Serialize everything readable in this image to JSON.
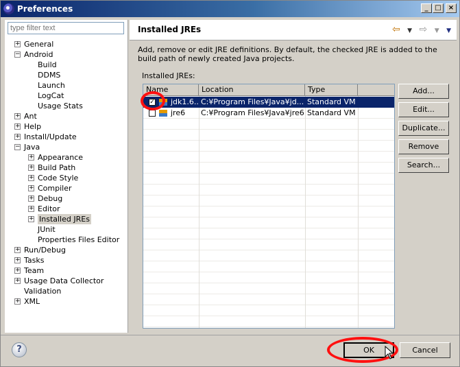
{
  "window": {
    "title": "Preferences"
  },
  "filter": {
    "placeholder": "type filter text"
  },
  "tree": [
    {
      "label": "General",
      "level": 0,
      "expander": "plus"
    },
    {
      "label": "Android",
      "level": 0,
      "expander": "minus"
    },
    {
      "label": "Build",
      "level": 1,
      "expander": "none"
    },
    {
      "label": "DDMS",
      "level": 1,
      "expander": "none"
    },
    {
      "label": "Launch",
      "level": 1,
      "expander": "none"
    },
    {
      "label": "LogCat",
      "level": 1,
      "expander": "none"
    },
    {
      "label": "Usage Stats",
      "level": 1,
      "expander": "none"
    },
    {
      "label": "Ant",
      "level": 0,
      "expander": "plus"
    },
    {
      "label": "Help",
      "level": 0,
      "expander": "plus"
    },
    {
      "label": "Install/Update",
      "level": 0,
      "expander": "plus"
    },
    {
      "label": "Java",
      "level": 0,
      "expander": "minus"
    },
    {
      "label": "Appearance",
      "level": 1,
      "expander": "plus"
    },
    {
      "label": "Build Path",
      "level": 1,
      "expander": "plus"
    },
    {
      "label": "Code Style",
      "level": 1,
      "expander": "plus"
    },
    {
      "label": "Compiler",
      "level": 1,
      "expander": "plus"
    },
    {
      "label": "Debug",
      "level": 1,
      "expander": "plus"
    },
    {
      "label": "Editor",
      "level": 1,
      "expander": "plus"
    },
    {
      "label": "Installed JREs",
      "level": 1,
      "expander": "plus",
      "selected": true
    },
    {
      "label": "JUnit",
      "level": 1,
      "expander": "none"
    },
    {
      "label": "Properties Files Editor",
      "level": 1,
      "expander": "none"
    },
    {
      "label": "Run/Debug",
      "level": 0,
      "expander": "plus"
    },
    {
      "label": "Tasks",
      "level": 0,
      "expander": "plus"
    },
    {
      "label": "Team",
      "level": 0,
      "expander": "plus"
    },
    {
      "label": "Usage Data Collector",
      "level": 0,
      "expander": "plus"
    },
    {
      "label": "Validation",
      "level": 0,
      "expander": "none"
    },
    {
      "label": "XML",
      "level": 0,
      "expander": "plus"
    }
  ],
  "page": {
    "title": "Installed JREs",
    "description": "Add, remove or edit JRE definitions. By default, the checked JRE is added to the build path of newly created Java projects.",
    "table_label": "Installed JREs:"
  },
  "table": {
    "columns": [
      "Name",
      "Location",
      "Type"
    ],
    "rows": [
      {
        "checked": true,
        "name": "jdk1.6...",
        "location": "C:¥Program Files¥Java¥jd...",
        "type": "Standard VM",
        "selected": true
      },
      {
        "checked": false,
        "name": "jre6",
        "location": "C:¥Program Files¥Java¥jre6",
        "type": "Standard VM",
        "selected": false
      }
    ]
  },
  "buttons": {
    "add": "Add...",
    "edit": "Edit...",
    "duplicate": "Duplicate...",
    "remove": "Remove",
    "search": "Search..."
  },
  "dialog_buttons": {
    "ok": "OK",
    "cancel": "Cancel"
  },
  "help": {
    "glyph": "?"
  },
  "annotation_color": "#ff1010",
  "selection_color": "#0a246a"
}
